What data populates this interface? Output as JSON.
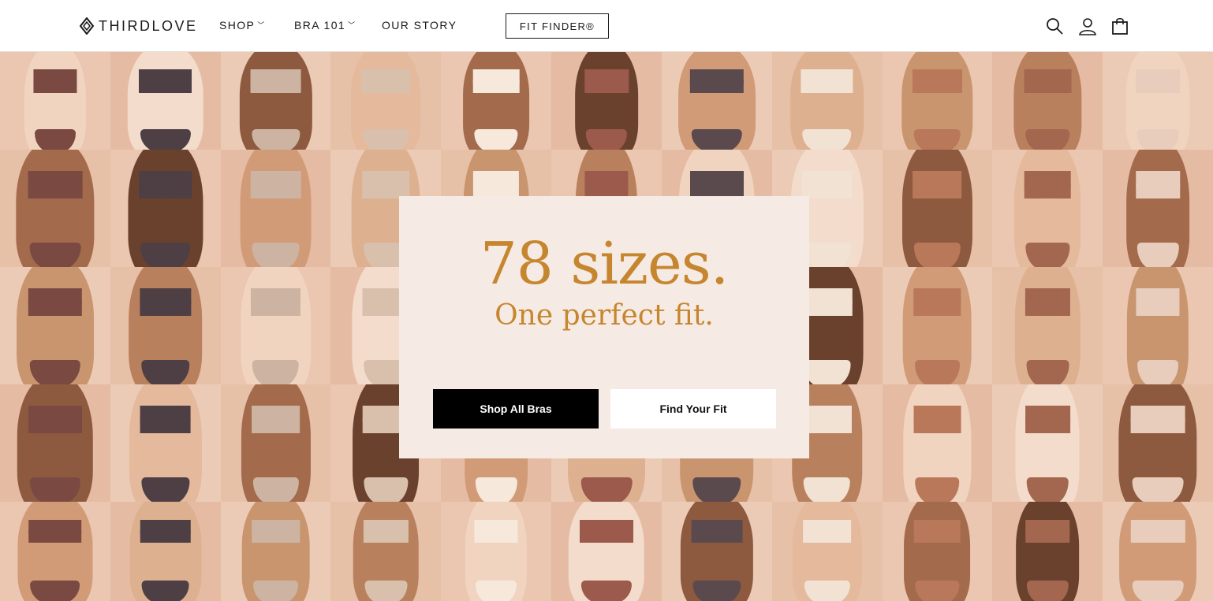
{
  "header": {
    "logo_text": "THIRDLOVE",
    "nav": [
      {
        "label": "SHOP",
        "has_dropdown": true
      },
      {
        "label": "BRA 101",
        "has_dropdown": true
      },
      {
        "label": "OUR STORY",
        "has_dropdown": false
      }
    ],
    "fit_finder_label": "FIT FINDER®",
    "icons": [
      "search-icon",
      "account-icon",
      "cart-icon"
    ]
  },
  "hero": {
    "headline": "78 sizes.",
    "subline": "One perfect fit.",
    "primary_button": "Shop All Bras",
    "secondary_button": "Find Your Fit"
  },
  "colors": {
    "accent": "#c6862f",
    "card_bg": "#f6ebe4",
    "backdrop": "#e9c3ac"
  }
}
